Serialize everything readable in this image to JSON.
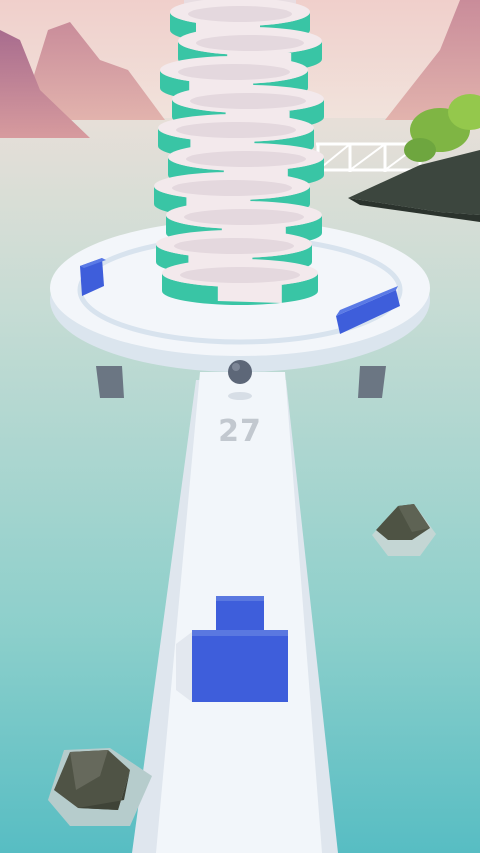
{
  "game": {
    "score": "27",
    "tower_rings": 10
  },
  "colors": {
    "sky_top": "#f1d3cc",
    "sky_bottom": "#efe2dc",
    "water_top": "#c8ddd5",
    "water_bottom": "#5fc1c4",
    "ring_teal": "#39c5a5",
    "ring_white": "#f3e9ec",
    "platform": "#f2f6fa",
    "platform_inner": "#dfe9f2",
    "block_blue": "#3e5edb",
    "ball": "#5d6778",
    "mountain": "#b97d9a",
    "rock": "#55584a",
    "island": "#3e4a3f",
    "bush": "#8cc04a"
  }
}
